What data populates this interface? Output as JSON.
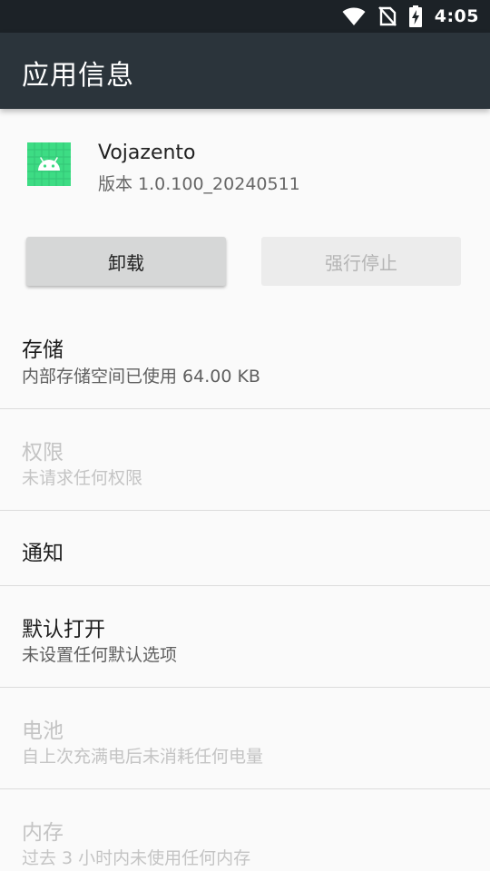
{
  "status_bar": {
    "time": "4:05",
    "icons": [
      "wifi-icon",
      "no-sim-icon",
      "battery-charging-icon"
    ]
  },
  "app_bar": {
    "title": "应用信息"
  },
  "app": {
    "name": "Vojazento",
    "version": "版本 1.0.100_20240511",
    "icon": "android-icon",
    "icon_color": "#3ddc84"
  },
  "buttons": {
    "uninstall": "卸载",
    "force_stop": "强行停止"
  },
  "items": [
    {
      "title": "存储",
      "summary": "内部存储空间已使用 64.00 KB",
      "enabled": true
    },
    {
      "title": "权限",
      "summary": "未请求任何权限",
      "enabled": false
    },
    {
      "title": "通知",
      "summary": "",
      "enabled": true
    },
    {
      "title": "默认打开",
      "summary": "未设置任何默认选项",
      "enabled": true
    },
    {
      "title": "电池",
      "summary": "自上次充满电后未消耗任何电量",
      "enabled": false
    },
    {
      "title": "内存",
      "summary": "过去 3 小时内未使用任何内存",
      "enabled": false
    }
  ]
}
